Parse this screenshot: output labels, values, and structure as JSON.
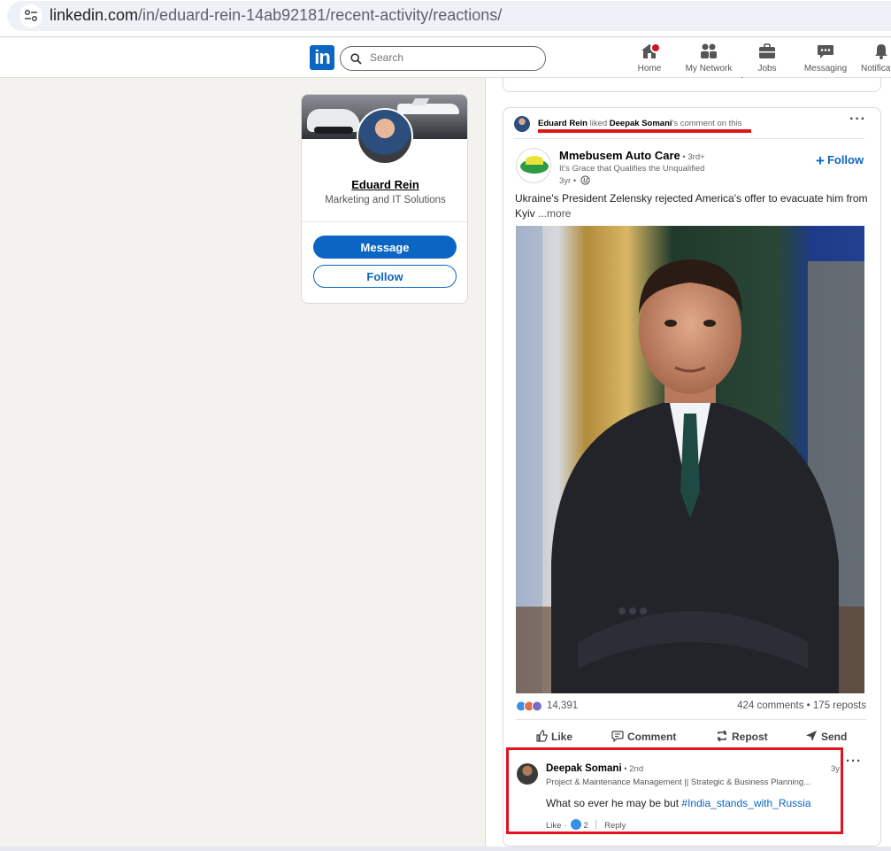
{
  "browser": {
    "url_host": "linkedin.com",
    "url_path": "/in/eduard-rein-14ab92181/recent-activity/reactions/"
  },
  "nav": {
    "logo_text": "in",
    "search_placeholder": "Search",
    "items": [
      {
        "label": "Home",
        "icon": "home-icon"
      },
      {
        "label": "My Network",
        "icon": "network-icon"
      },
      {
        "label": "Jobs",
        "icon": "briefcase-icon"
      },
      {
        "label": "Messaging",
        "icon": "messaging-icon"
      },
      {
        "label": "Notificat",
        "icon": "bell-icon"
      }
    ]
  },
  "profile": {
    "name": "Eduard Rein",
    "headline": "Marketing and IT Solutions",
    "message_label": "Message",
    "follow_label": "Follow"
  },
  "post": {
    "activity": {
      "actor": "Eduard Rein",
      "verb": " liked ",
      "target": "Deepak Somani",
      "suffix": "'s comment on this"
    },
    "author": {
      "name": "Mmebusem Auto Care",
      "degree": " • 3rd+",
      "tagline": "It's Grace that Qualifies the Unqualified",
      "time": "3yr •"
    },
    "follow_label": "Follow",
    "text": "Ukraine's President Zelensky rejected America's offer to evacuate him from Kyiv",
    "more_label": "...more",
    "reaction_count": "14,391",
    "comments_reposts": "424 comments • 175 reposts",
    "actions": {
      "like": "Like",
      "comment": "Comment",
      "repost": "Repost",
      "send": "Send"
    }
  },
  "comment": {
    "name": "Deepak Somani",
    "degree": " • 2nd",
    "headline": "Project & Maintenance Management || Strategic & Business Planning...",
    "time": "3y",
    "text_plain": "What so ever he may be but ",
    "hashtag": "#India_stands_with_Russia",
    "like_label": "Like",
    "like_count": "2",
    "reply_label": "Reply"
  },
  "colors": {
    "brand": "#0a66c2",
    "highlight_red": "#e0141f",
    "notification": "#cb112d"
  }
}
